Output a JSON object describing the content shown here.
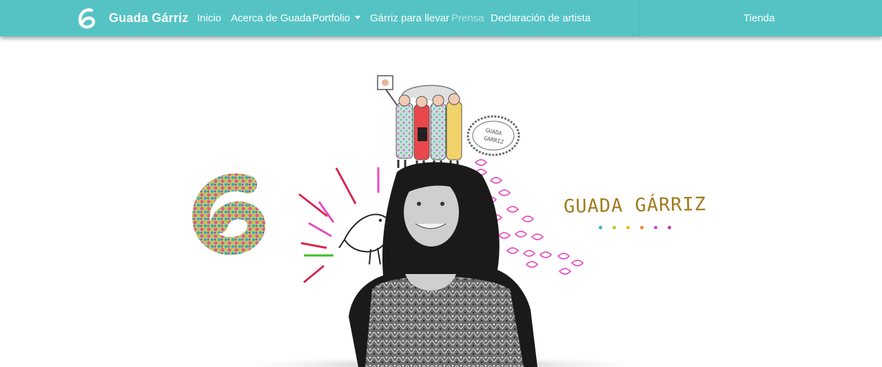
{
  "navbar": {
    "brand": "Guada Gárriz",
    "brand_icon": "g-logo-icon",
    "items": [
      {
        "label": "Inicio"
      },
      {
        "label": "Acerca de Guada"
      },
      {
        "label": "Portfolio"
      },
      {
        "label": "Gárriz para llevar"
      },
      {
        "label": "Prensa"
      },
      {
        "label": "Declaración de artista"
      }
    ],
    "right": {
      "label": "Tienda"
    }
  },
  "hero": {
    "signature": "GUADA GÁRRIZ",
    "stamp_text_1": "GUADA",
    "stamp_text_2": "GARRIZ",
    "dot_colors": [
      "#2fb7b2",
      "#a5d22e",
      "#f5b51c",
      "#f28a1d",
      "#c74fd6",
      "#c037b5"
    ]
  },
  "colors": {
    "navbar_bg": "#55c3c4",
    "signature": "#a07c1e",
    "accent_pink": "#e64cbf"
  }
}
